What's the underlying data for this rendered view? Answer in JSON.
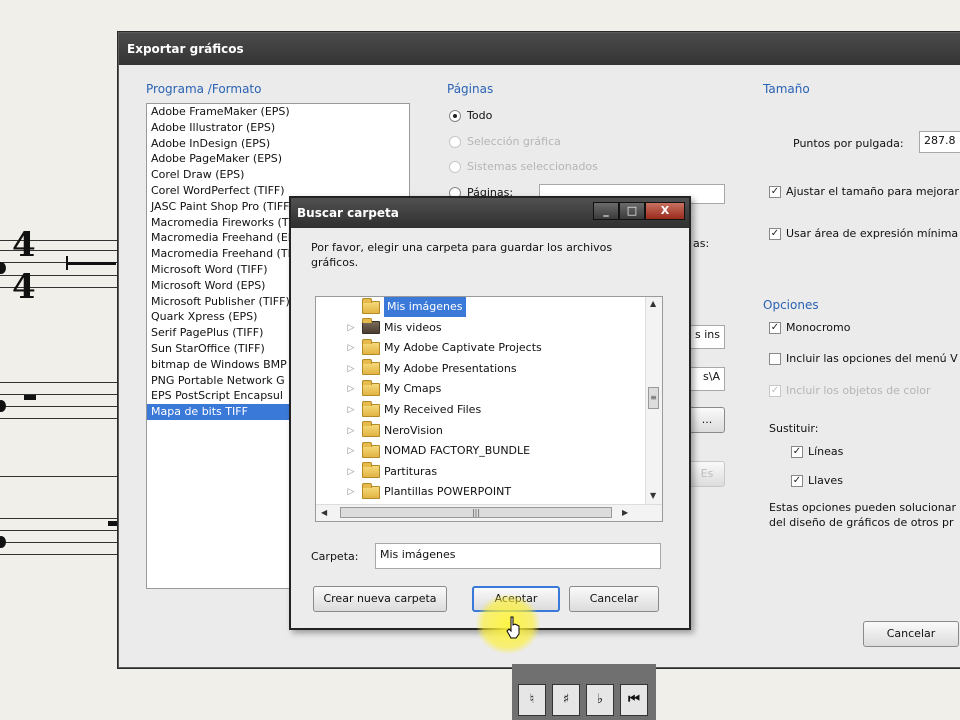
{
  "export_dialog": {
    "title": "Exportar gráficos",
    "format_group_label": "Programa /Formato",
    "formats": [
      "Adobe FrameMaker (EPS)",
      "Adobe Illustrator (EPS)",
      "Adobe InDesign (EPS)",
      "Adobe PageMaker (EPS)",
      "Corel Draw (EPS)",
      "Corel WordPerfect (TIFF)",
      "JASC Paint Shop Pro (TIFF)",
      "Macromedia Fireworks (TIFF)",
      "Macromedia Freehand (EPS)",
      "Macromedia Freehand (TIFF)",
      "Microsoft Word (TIFF)",
      "Microsoft Word (EPS)",
      "Microsoft Publisher (TIFF)",
      "Quark Xpress (EPS)",
      "Serif PagePlus (TIFF)",
      "Sun StarOffice (TIFF)",
      "bitmap de Windows BMP",
      "PNG Portable Network G",
      "EPS PostScript Encapsul",
      "Mapa de bits TIFF"
    ],
    "selected_format_index": 19,
    "pages": {
      "label": "Páginas",
      "all": "Todo",
      "selection": "Selección gráfica",
      "selected_systems": "Sistemas seleccionados",
      "pages_option": "Páginas:",
      "pages_value": "",
      "partial_text": "as:",
      "file_field_value": "s ins",
      "path_field_value": "s\\A"
    },
    "size": {
      "label": "Tamaño",
      "dpi_label": "Puntos por pulgada:",
      "dpi_value": "287.8",
      "adjust_size": "Ajustar el tamaño para mejorar",
      "use_min_area": "Usar área de expresión mínima"
    },
    "options": {
      "label": "Opciones",
      "monochrome": "Monocromo",
      "include_menu": "Incluir las opciones del menú V",
      "include_color": "Incluir los objetos de color",
      "substitute": "Sustituir:",
      "lines": "Líneas",
      "keys": "Llaves",
      "note": "Estas opciones pueden solucionar",
      "note2": "del diseño de gráficos de otros pr"
    },
    "small_button": "...",
    "ok_partial_button": "Es",
    "cancel_button": "Cancelar"
  },
  "folder_dialog": {
    "title": "Buscar carpeta",
    "prompt": "Por favor, elegir una carpeta para guardar los archivos gráficos.",
    "tree": [
      {
        "label": "Mis imágenes",
        "selected": true,
        "icon": "folder"
      },
      {
        "label": "Mis videos",
        "selected": false,
        "icon": "video-folder"
      },
      {
        "label": "My Adobe Captivate Projects",
        "selected": false,
        "icon": "folder"
      },
      {
        "label": "My Adobe Presentations",
        "selected": false,
        "icon": "folder"
      },
      {
        "label": "My Cmaps",
        "selected": false,
        "icon": "folder"
      },
      {
        "label": "My Received Files",
        "selected": false,
        "icon": "folder"
      },
      {
        "label": "NeroVision",
        "selected": false,
        "icon": "folder"
      },
      {
        "label": "NOMAD FACTORY_BUNDLE",
        "selected": false,
        "icon": "folder"
      },
      {
        "label": "Partituras",
        "selected": false,
        "icon": "folder"
      },
      {
        "label": "Plantillas POWERPOINT",
        "selected": false,
        "icon": "folder"
      }
    ],
    "folder_label": "Carpeta:",
    "folder_value": "Mis imágenes",
    "new_folder_button": "Crear nueva carpeta",
    "accept_button": "Aceptar",
    "cancel_button": "Cancelar",
    "window_buttons": {
      "minimize": "_",
      "maximize": "□",
      "close": "X"
    }
  },
  "palette": {
    "buttons": [
      "♮",
      "♯",
      "♭",
      "⏮"
    ]
  },
  "score": {
    "time_sig_top": "4",
    "time_sig_bottom": "4"
  }
}
